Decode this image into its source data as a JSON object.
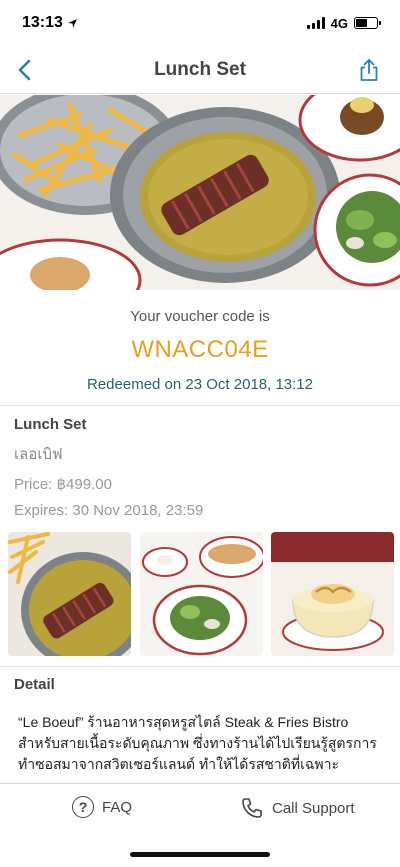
{
  "status_bar": {
    "time": "13:13",
    "network": "4G"
  },
  "nav": {
    "title": "Lunch Set",
    "back_icon": "chevron-left-icon",
    "share_icon": "share-icon"
  },
  "voucher": {
    "label": "Your voucher code is",
    "code": "WNACC04E",
    "redeemed": "Redeemed on 23 Oct 2018, 13:12",
    "code_color": "#e8a020",
    "redeemed_color": "#2f5f66"
  },
  "info": {
    "title": "Lunch Set",
    "subtitle": "เลอเบิฟ",
    "price": "Price: ฿499.00",
    "expires": "Expires: 30 Nov 2018, 23:59"
  },
  "thumbnails": [
    {
      "alt": "steak-with-fries-photo"
    },
    {
      "alt": "baguette-and-salad-photo"
    },
    {
      "alt": "dessert-photo"
    }
  ],
  "detail": {
    "heading": "Detail",
    "body": "“Le Boeuf” ร้านอาหารสุดหรูสไตล์ Steak & Fries Bistro สำหรับสายเนื้อระดับคุณภาพ ซึ่งทางร้านได้ไปเรียนรู้สูตรการทำซอสมาจากสวิตเซอร์แลนด์ ทำให้ได้รสชาติที่เฉพาะตัวอย่างยิ่ง เริ่มความฟินด้วย “Walnut Green Salad with Vinaigrette"
  },
  "bottom_bar": {
    "faq_label": "FAQ",
    "support_label": "Call Support"
  },
  "colors": {
    "accent_blue": "#2a7fb8",
    "text_dark": "#444444"
  }
}
